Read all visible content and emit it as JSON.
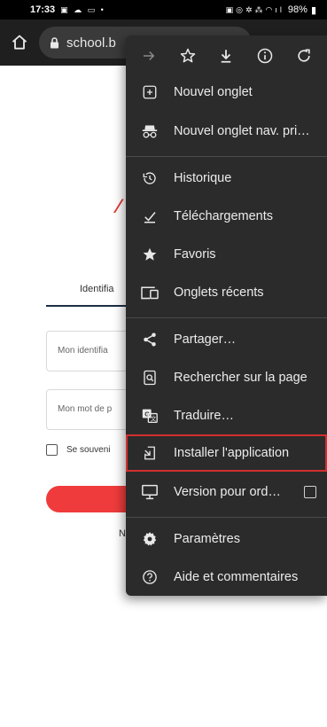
{
  "status_bar": {
    "time": "17:33",
    "battery": "98%"
  },
  "address_bar": {
    "url": "school.b"
  },
  "page": {
    "tab_label": "Identifia",
    "identifier_placeholder": "Mon identifia",
    "password_placeholder": "Mon mot de p",
    "remember_label": "Se souveni",
    "partial_text": "N"
  },
  "menu": {
    "items": [
      {
        "label": "Nouvel onglet",
        "icon": "new-tab-icon"
      },
      {
        "label": "Nouvel onglet nav. pri…",
        "icon": "incognito-icon"
      },
      {
        "label": "Historique",
        "icon": "history-icon"
      },
      {
        "label": "Téléchargements",
        "icon": "downloads-icon"
      },
      {
        "label": "Favoris",
        "icon": "star-icon"
      },
      {
        "label": "Onglets récents",
        "icon": "recent-tabs-icon"
      },
      {
        "label": "Partager…",
        "icon": "share-icon"
      },
      {
        "label": "Rechercher sur la page",
        "icon": "find-in-page-icon"
      },
      {
        "label": "Traduire…",
        "icon": "translate-icon"
      },
      {
        "label": "Installer l'application",
        "icon": "install-app-icon"
      },
      {
        "label": "Version pour ord…",
        "icon": "desktop-icon"
      },
      {
        "label": "Paramètres",
        "icon": "settings-icon"
      },
      {
        "label": "Aide et commentaires",
        "icon": "help-icon"
      }
    ]
  },
  "colors": {
    "menu_bg": "#2b2b2b",
    "highlight": "#d32f2f",
    "brand_red": "#ef3b3b"
  }
}
